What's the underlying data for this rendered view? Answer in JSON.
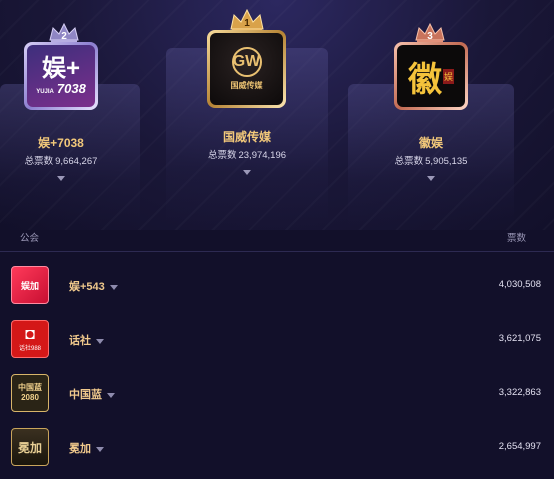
{
  "podium": {
    "second": {
      "rank": "2",
      "name": "娱+7038",
      "vote_label": "总票数",
      "votes": "9,664,267",
      "logo_main": "娱+",
      "logo_sub": "YUJIA",
      "logo_num": "7038"
    },
    "first": {
      "rank": "1",
      "name": "国威传媒",
      "vote_label": "总票数",
      "votes": "23,974,196",
      "logo_main": "GW",
      "logo_sub": "国威传媒"
    },
    "third": {
      "rank": "3",
      "name": "徽娱",
      "vote_label": "总票数",
      "votes": "5,905,135",
      "logo_main": "徽",
      "logo_sub": "娱"
    }
  },
  "list": {
    "header_left": "公会",
    "header_right": "票数",
    "rows": [
      {
        "name": "娱+543",
        "votes": "4,030,508",
        "logo_text": "娱加"
      },
      {
        "name": "话社",
        "votes": "3,621,075",
        "logo_text": "话社988"
      },
      {
        "name": "中国蓝",
        "votes": "3,322,863",
        "logo_text": "中国蓝2080"
      },
      {
        "name": "冕加",
        "votes": "2,654,997",
        "logo_text": "冕加"
      }
    ]
  },
  "colors": {
    "background": "#12102a",
    "gold": "#f2c87a",
    "silver_frame": "#a99cd8",
    "gold_frame": "#e0b56c",
    "bronze_frame": "#e39a7c"
  }
}
